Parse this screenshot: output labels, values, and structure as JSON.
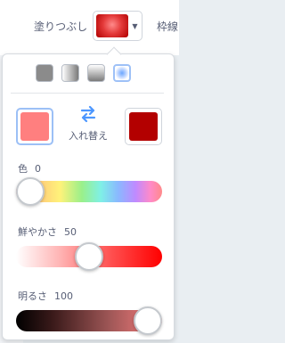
{
  "toolbar": {
    "fill_label": "塗りつぶし",
    "outline_label": "枠線",
    "fill_color": "#e43a3a"
  },
  "gradient_modes": [
    {
      "name": "solid",
      "selected": false
    },
    {
      "name": "horizontal-gradient",
      "selected": false
    },
    {
      "name": "vertical-gradient",
      "selected": false
    },
    {
      "name": "radial-gradient",
      "selected": true
    }
  ],
  "colors": {
    "primary": "#ff7f7f",
    "secondary": "#b30000"
  },
  "swap": {
    "label": "入れ替え",
    "icon": "swap-arrows-icon"
  },
  "sliders": {
    "hue": {
      "label": "色",
      "value": "0",
      "fraction": 0.0
    },
    "saturation": {
      "label": "鮮やかさ",
      "value": "50",
      "fraction": 0.5
    },
    "brightness": {
      "label": "明るさ",
      "value": "100",
      "fraction": 1.0
    }
  }
}
